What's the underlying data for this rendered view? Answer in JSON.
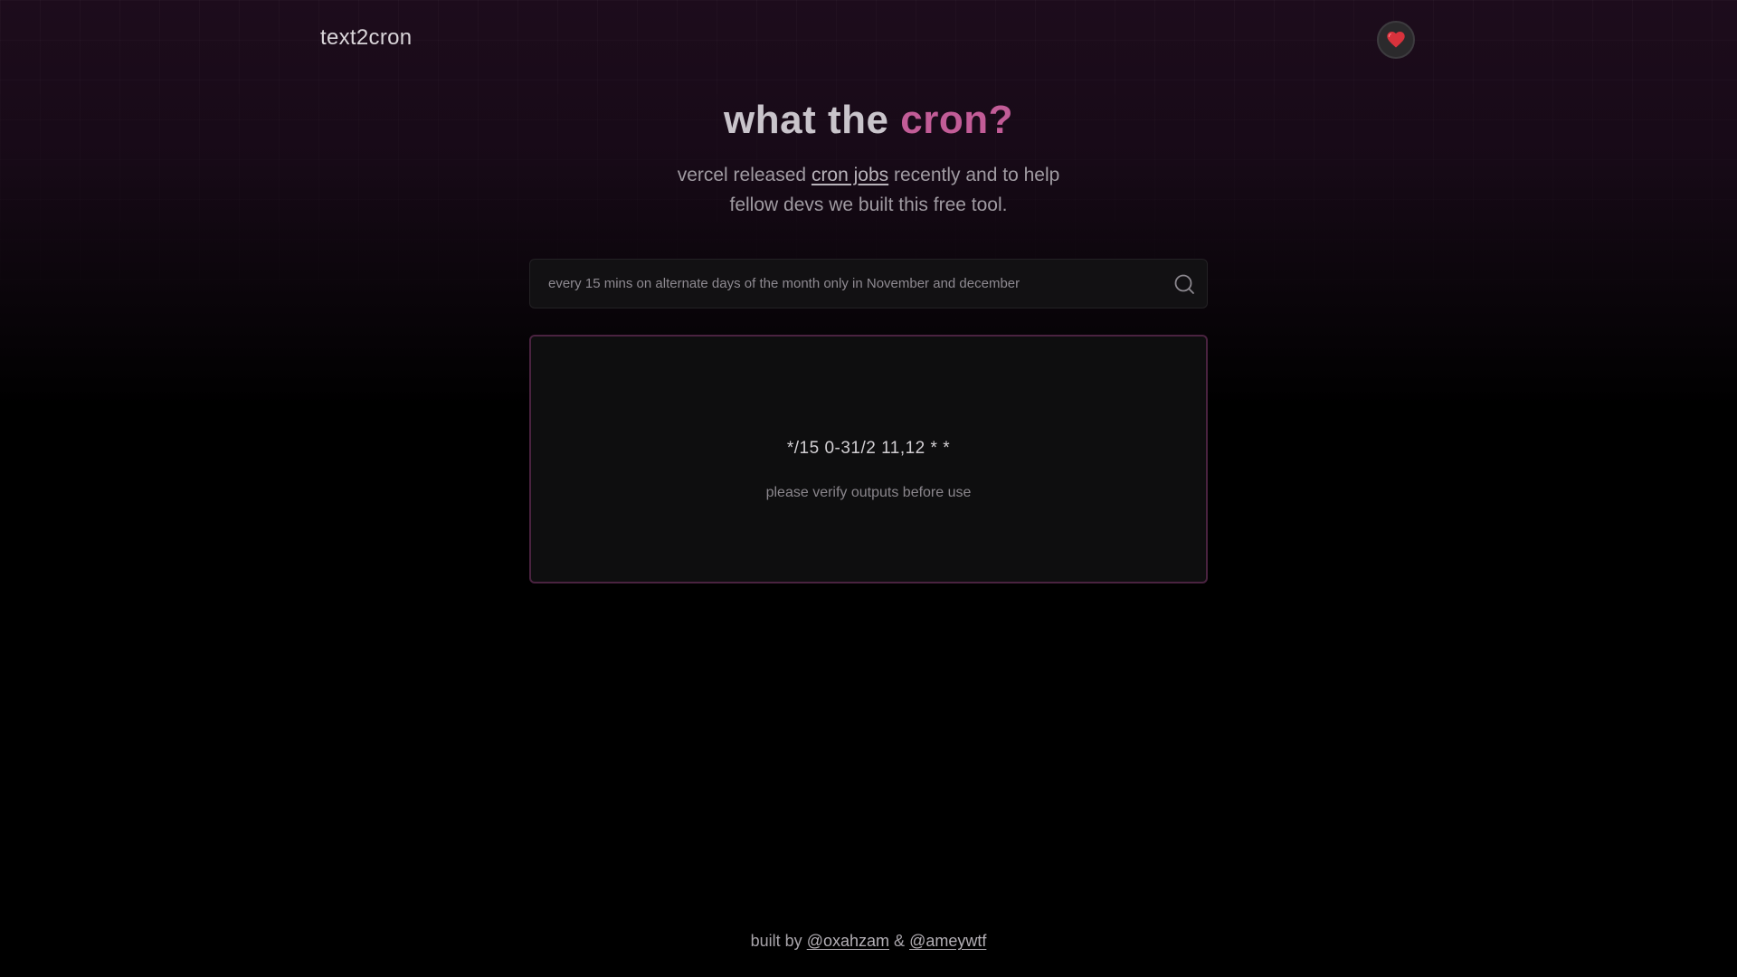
{
  "header": {
    "logo_text": "text2cron",
    "heart_icon": "heart-icon"
  },
  "hero": {
    "title_plain": "what the",
    "title_accent": "cron?",
    "subtitle_line1_before": "vercel released",
    "subtitle_link": "cron jobs",
    "subtitle_line1_after": "recently and to help",
    "subtitle_line2": "fellow devs we built this free tool."
  },
  "search": {
    "placeholder": "every 15 mins on alternate days of the month only in November and december",
    "value": "",
    "icon": "search-icon"
  },
  "result": {
    "cron_expression": "*/15 0-31/2 11,12 * *",
    "note": "please verify outputs before use"
  },
  "footer": {
    "prefix": "built by",
    "author1": "@oxahzam",
    "separator": "&",
    "author2": "@ameywtf"
  },
  "colors": {
    "accent": "#c25c97",
    "background_top": "#1d0c1c",
    "background_bottom": "#000000",
    "card_border": "#4a2340",
    "heart": "#d8323c"
  }
}
